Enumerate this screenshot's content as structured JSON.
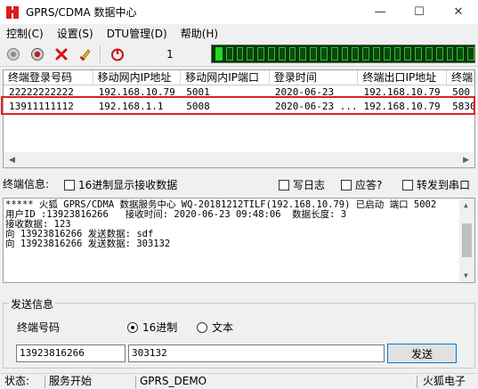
{
  "window": {
    "title": "GPRS/CDMA 数据中心",
    "minimize": "—",
    "maximize": "☐",
    "close": "✕"
  },
  "menu": [
    "控制(C)",
    "设置(S)",
    "DTU管理(D)",
    "帮助(H)"
  ],
  "toolbar": {
    "page": "1",
    "icons": [
      "start-icon",
      "stop-icon",
      "delete-icon",
      "edit-icon",
      "exit-icon"
    ],
    "led_segments_total": 25,
    "led_segments_on": 1
  },
  "table": {
    "columns": [
      "终端登录号码",
      "移动网内IP地址",
      "移动网内IP端口",
      "登录时间",
      "终端出口IP地址",
      "终端"
    ],
    "rows": [
      [
        "22222222222",
        "192.168.10.79",
        "5001",
        "2020-06-23",
        "192.168.10.79",
        "500"
      ],
      [
        "13911111112",
        "192.168.1.1",
        "5008",
        "2020-06-23 ...",
        "192.168.10.79",
        "5830"
      ]
    ]
  },
  "info": {
    "label": "终端信息:",
    "hex_display": "16进制显示接收数据",
    "write_log": "写日志",
    "answer": "应答?",
    "forward": "转发到串口"
  },
  "log": [
    "***** 火狐 GPRS/CDMA 数据服务中心 WQ-20181212TILF(192.168.10.79) 已启动 端口 5002",
    "",
    "用户ID :13923816266   接收时间: 2020-06-23 09:48:06  数据长度: 3",
    "接收数据: 123",
    "向 13923816266 发送数据: sdf",
    "向 13923816266 发送数据: 303132"
  ],
  "send": {
    "legend": "发送信息",
    "terminal_label": "终端号码",
    "hex_option": "16进制",
    "text_option": "文本",
    "terminal_value": "13923816266",
    "data_value": "303132",
    "send_button": "发送"
  },
  "status": {
    "label": "状态:",
    "state": "服务开始",
    "mode": "GPRS_DEMO",
    "brand": "火狐电子"
  },
  "colors": {
    "led_bg": "#063806",
    "led_on": "#22d822",
    "highlight": "#e02020",
    "accent": "#0078d7"
  }
}
